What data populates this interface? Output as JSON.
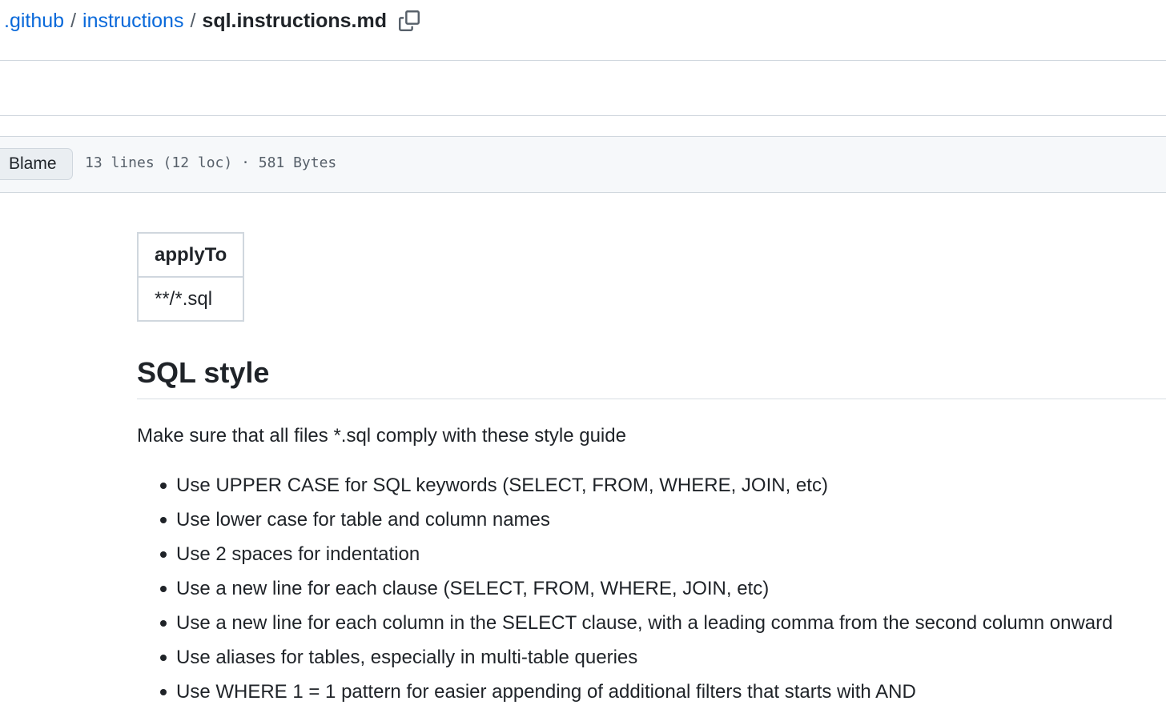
{
  "breadcrumb": {
    "items": [
      ".github",
      "instructions"
    ],
    "separator": "/",
    "file": "sql.instructions.md"
  },
  "file_bar": {
    "blame_label": "Blame",
    "info": "13 lines (12 loc) · 581 Bytes"
  },
  "frontmatter": {
    "header": "applyTo",
    "value": "**/*.sql"
  },
  "content": {
    "heading": "SQL style",
    "intro": "Make sure that all files *.sql comply with these style guide",
    "rules": [
      "Use UPPER CASE for SQL keywords (SELECT, FROM, WHERE, JOIN, etc)",
      "Use lower case for table and column names",
      "Use 2 spaces for indentation",
      "Use a new line for each clause (SELECT, FROM, WHERE, JOIN, etc)",
      "Use a new line for each column in the SELECT clause, with a leading comma from the second column onward",
      "Use aliases for tables, especially in multi-table queries",
      "Use WHERE 1 = 1 pattern for easier appending of additional filters that starts with AND"
    ]
  },
  "icons": {
    "copy": "copy-icon"
  },
  "colors": {
    "link": "#0969da",
    "text": "#1f2328",
    "muted": "#57606a",
    "border": "#d0d7de",
    "toolbar_bg": "#f6f8fa"
  }
}
